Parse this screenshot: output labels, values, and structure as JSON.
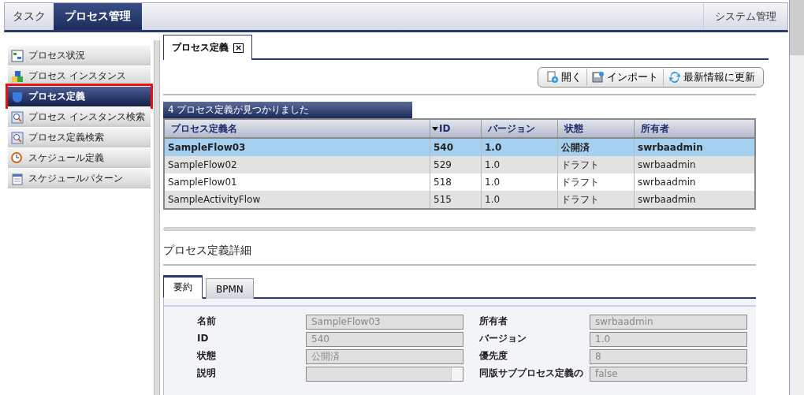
{
  "top_tabs": [
    {
      "label": "タスク",
      "selected": false
    },
    {
      "label": "プロセス管理",
      "selected": true
    }
  ],
  "system_menu": "システム管理",
  "sidebar": {
    "items": [
      {
        "label": "プロセス状況",
        "selected": false
      },
      {
        "label": "プロセス インスタンス",
        "selected": false
      },
      {
        "label": "プロセス定義",
        "selected": true
      },
      {
        "label": "プロセス インスタンス検索",
        "selected": false
      },
      {
        "label": "プロセス定義検索",
        "selected": false
      },
      {
        "label": "スケジュール定義",
        "selected": false
      },
      {
        "label": "スケジュールパターン",
        "selected": false
      }
    ]
  },
  "doc_tab": {
    "label": "プロセス定義",
    "close": "×"
  },
  "toolbar": [
    "開く",
    "インポート",
    "最新情報に更新"
  ],
  "table": {
    "caption": "4 プロセス定義が見つかりました",
    "columns": [
      {
        "label": "プロセス定義名",
        "sorted": false
      },
      {
        "label": "ID",
        "sorted": true
      },
      {
        "label": "バージョン",
        "sorted": false
      },
      {
        "label": "状態",
        "sorted": false
      },
      {
        "label": "所有者",
        "sorted": false
      }
    ],
    "rows": [
      {
        "cells": [
          "SampleFlow03",
          "540",
          "1.0",
          "公開済",
          "swrbaadmin"
        ],
        "selected": true
      },
      {
        "cells": [
          "SampleFlow02",
          "529",
          "1.0",
          "ドラフト",
          "swrbaadmin"
        ],
        "selected": false
      },
      {
        "cells": [
          "SampleFlow01",
          "518",
          "1.0",
          "ドラフト",
          "swrbaadmin"
        ],
        "selected": false
      },
      {
        "cells": [
          "SampleActivityFlow",
          "515",
          "1.0",
          "ドラフト",
          "swrbaadmin"
        ],
        "selected": false
      }
    ]
  },
  "details": {
    "title": "プロセス定義詳細",
    "tabs": [
      {
        "label": "要約",
        "selected": true
      },
      {
        "label": "BPMN",
        "selected": false
      }
    ],
    "fields": [
      {
        "label": "名前",
        "value": "SampleFlow03",
        "kind": "input"
      },
      {
        "label": "所有者",
        "value": "swrbaadmin",
        "kind": "input"
      },
      {
        "label": "ID",
        "value": "540",
        "kind": "input"
      },
      {
        "label": "バージョン",
        "value": "1.0",
        "kind": "input"
      },
      {
        "label": "状態",
        "value": "公開済",
        "kind": "input"
      },
      {
        "label": "優先度",
        "value": "8",
        "kind": "input"
      },
      {
        "label": "説明",
        "kind": "textarea"
      },
      {
        "label": "同版サブプロセス定義の",
        "value": "false",
        "kind": "input"
      }
    ]
  }
}
